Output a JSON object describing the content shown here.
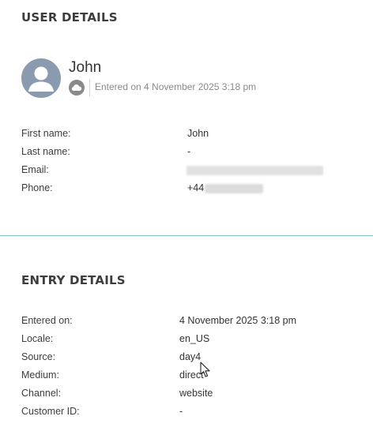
{
  "user_section": {
    "title": "USER DETAILS",
    "name": "John",
    "entered_meta": "Entered on 4 November 2025 3:18 pm",
    "rows": [
      {
        "label": "First name:",
        "value": "John"
      },
      {
        "label": "Last name:",
        "value": "-"
      },
      {
        "label": "Email:",
        "value": ""
      },
      {
        "label": "Phone:",
        "value": "+44"
      }
    ]
  },
  "entry_section": {
    "title": "ENTRY DETAILS",
    "rows": [
      {
        "label": "Entered on:",
        "value": "4 November 2025 3:18 pm"
      },
      {
        "label": "Locale:",
        "value": "en_US"
      },
      {
        "label": "Source:",
        "value": "day4"
      },
      {
        "label": "Medium:",
        "value": "direct"
      },
      {
        "label": "Channel:",
        "value": "website"
      },
      {
        "label": "Customer ID:",
        "value": "-"
      }
    ]
  },
  "icons": {
    "avatar": "user-silhouette-icon",
    "channel": "cloud-icon",
    "cursor": "mouse-pointer-icon"
  },
  "colors": {
    "avatar_bg": "#8a9bb0",
    "separator": "#7fc4cc",
    "muted_text": "#8a8a8a"
  }
}
